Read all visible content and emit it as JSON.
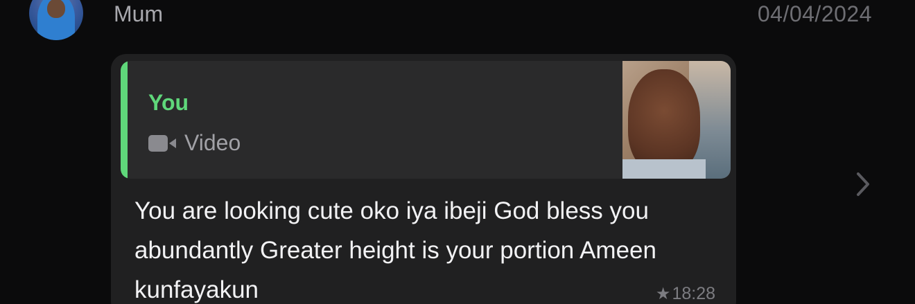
{
  "header": {
    "contact_name": "Mum",
    "date": "04/04/2024"
  },
  "message": {
    "quoted": {
      "author": "You",
      "type_label": "Video",
      "type_icon": "video-camera-icon"
    },
    "text": "You are looking cute oko iya ibeji God bless you abundantly Greater height is your portion Ameen kunfayakun",
    "starred": true,
    "time": "18:28"
  },
  "colors": {
    "background": "#0b0b0c",
    "bubble": "#202021",
    "quote_background": "#2a2a2b",
    "accent_green": "#5fd77a",
    "text_primary": "#f2f2f4",
    "text_secondary": "#a8a8ad",
    "text_muted": "#7c7c81"
  },
  "icons": {
    "star": "star-icon",
    "chevron": "chevron-right-icon"
  }
}
